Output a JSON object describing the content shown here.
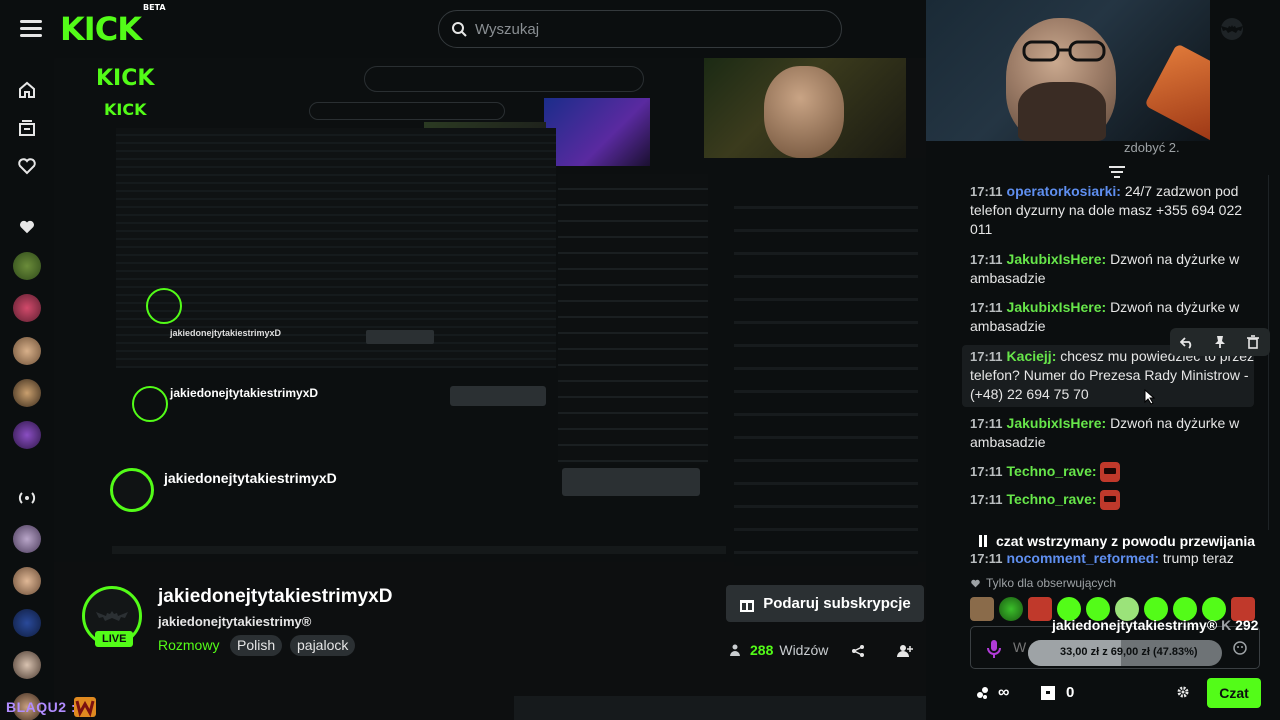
{
  "logo": {
    "text": "KICK",
    "badge": "BETA"
  },
  "search": {
    "placeholder": "Wyszukaj"
  },
  "channel": {
    "display_name": "jakiedonejtytakiestrimyxD",
    "sub_name": "jakiedonejtytakiestrimy®",
    "category": "Rozmowy",
    "tags": [
      "Polish",
      "pajalock"
    ],
    "live_label": "LIVE",
    "gift_label": "Podaruj subskrypcje",
    "viewers_count": "288",
    "viewers_label": "Widzów"
  },
  "chat": {
    "top_text": "zdobyć 2.",
    "messages": [
      {
        "time": "17:11",
        "user": "operatorkosiarki",
        "user_color": "blue",
        "text": "24/7 zadzwon pod telefon dyzurny na dole masz +355 694 022 011"
      },
      {
        "time": "17:11",
        "user": "JakubixIsHere",
        "user_color": "green",
        "text": "Dzwoń na dyżurke w ambasadzie"
      },
      {
        "time": "17:11",
        "user": "JakubixIsHere",
        "user_color": "green",
        "text": "Dzwoń na dyżurke w ambasadzie"
      },
      {
        "time": "17:11",
        "user": "Kaciejj",
        "user_color": "green",
        "text": "chcesz mu powiedzieć to przez telefon? Numer do Prezesa Rady Ministrow - (+48) 22 694 75 70"
      },
      {
        "time": "17:11",
        "user": "JakubixIsHere",
        "user_color": "green",
        "text": "Dzwoń na dyżurke w ambasadzie"
      },
      {
        "time": "17:11",
        "user": "Techno_rave",
        "user_color": "green",
        "text": ""
      },
      {
        "time": "17:11",
        "user": "Techno_rave",
        "user_color": "green",
        "text": ""
      },
      {
        "time": "17:11",
        "user": "nocomment_reformed",
        "user_color": "blue",
        "text": "trump teraz"
      }
    ],
    "paused_text": "czat wstrzymany z powodu przewijania",
    "followers_only": "Tylko dla obserwujących",
    "input_placeholder": "W",
    "goal_name": "jakiedonejtytakiestrimy®",
    "goal_count": "292",
    "goal_text": "33,00 zł z 69,00 zł (47.83%)",
    "goal_progress": 0.4783,
    "points_count": "",
    "box_count": "0",
    "send_label": "Czat"
  },
  "overlay": {
    "name": "BLAQU2 :"
  },
  "colors": {
    "accent": "#53fc18",
    "background": "#0b0e0f"
  }
}
